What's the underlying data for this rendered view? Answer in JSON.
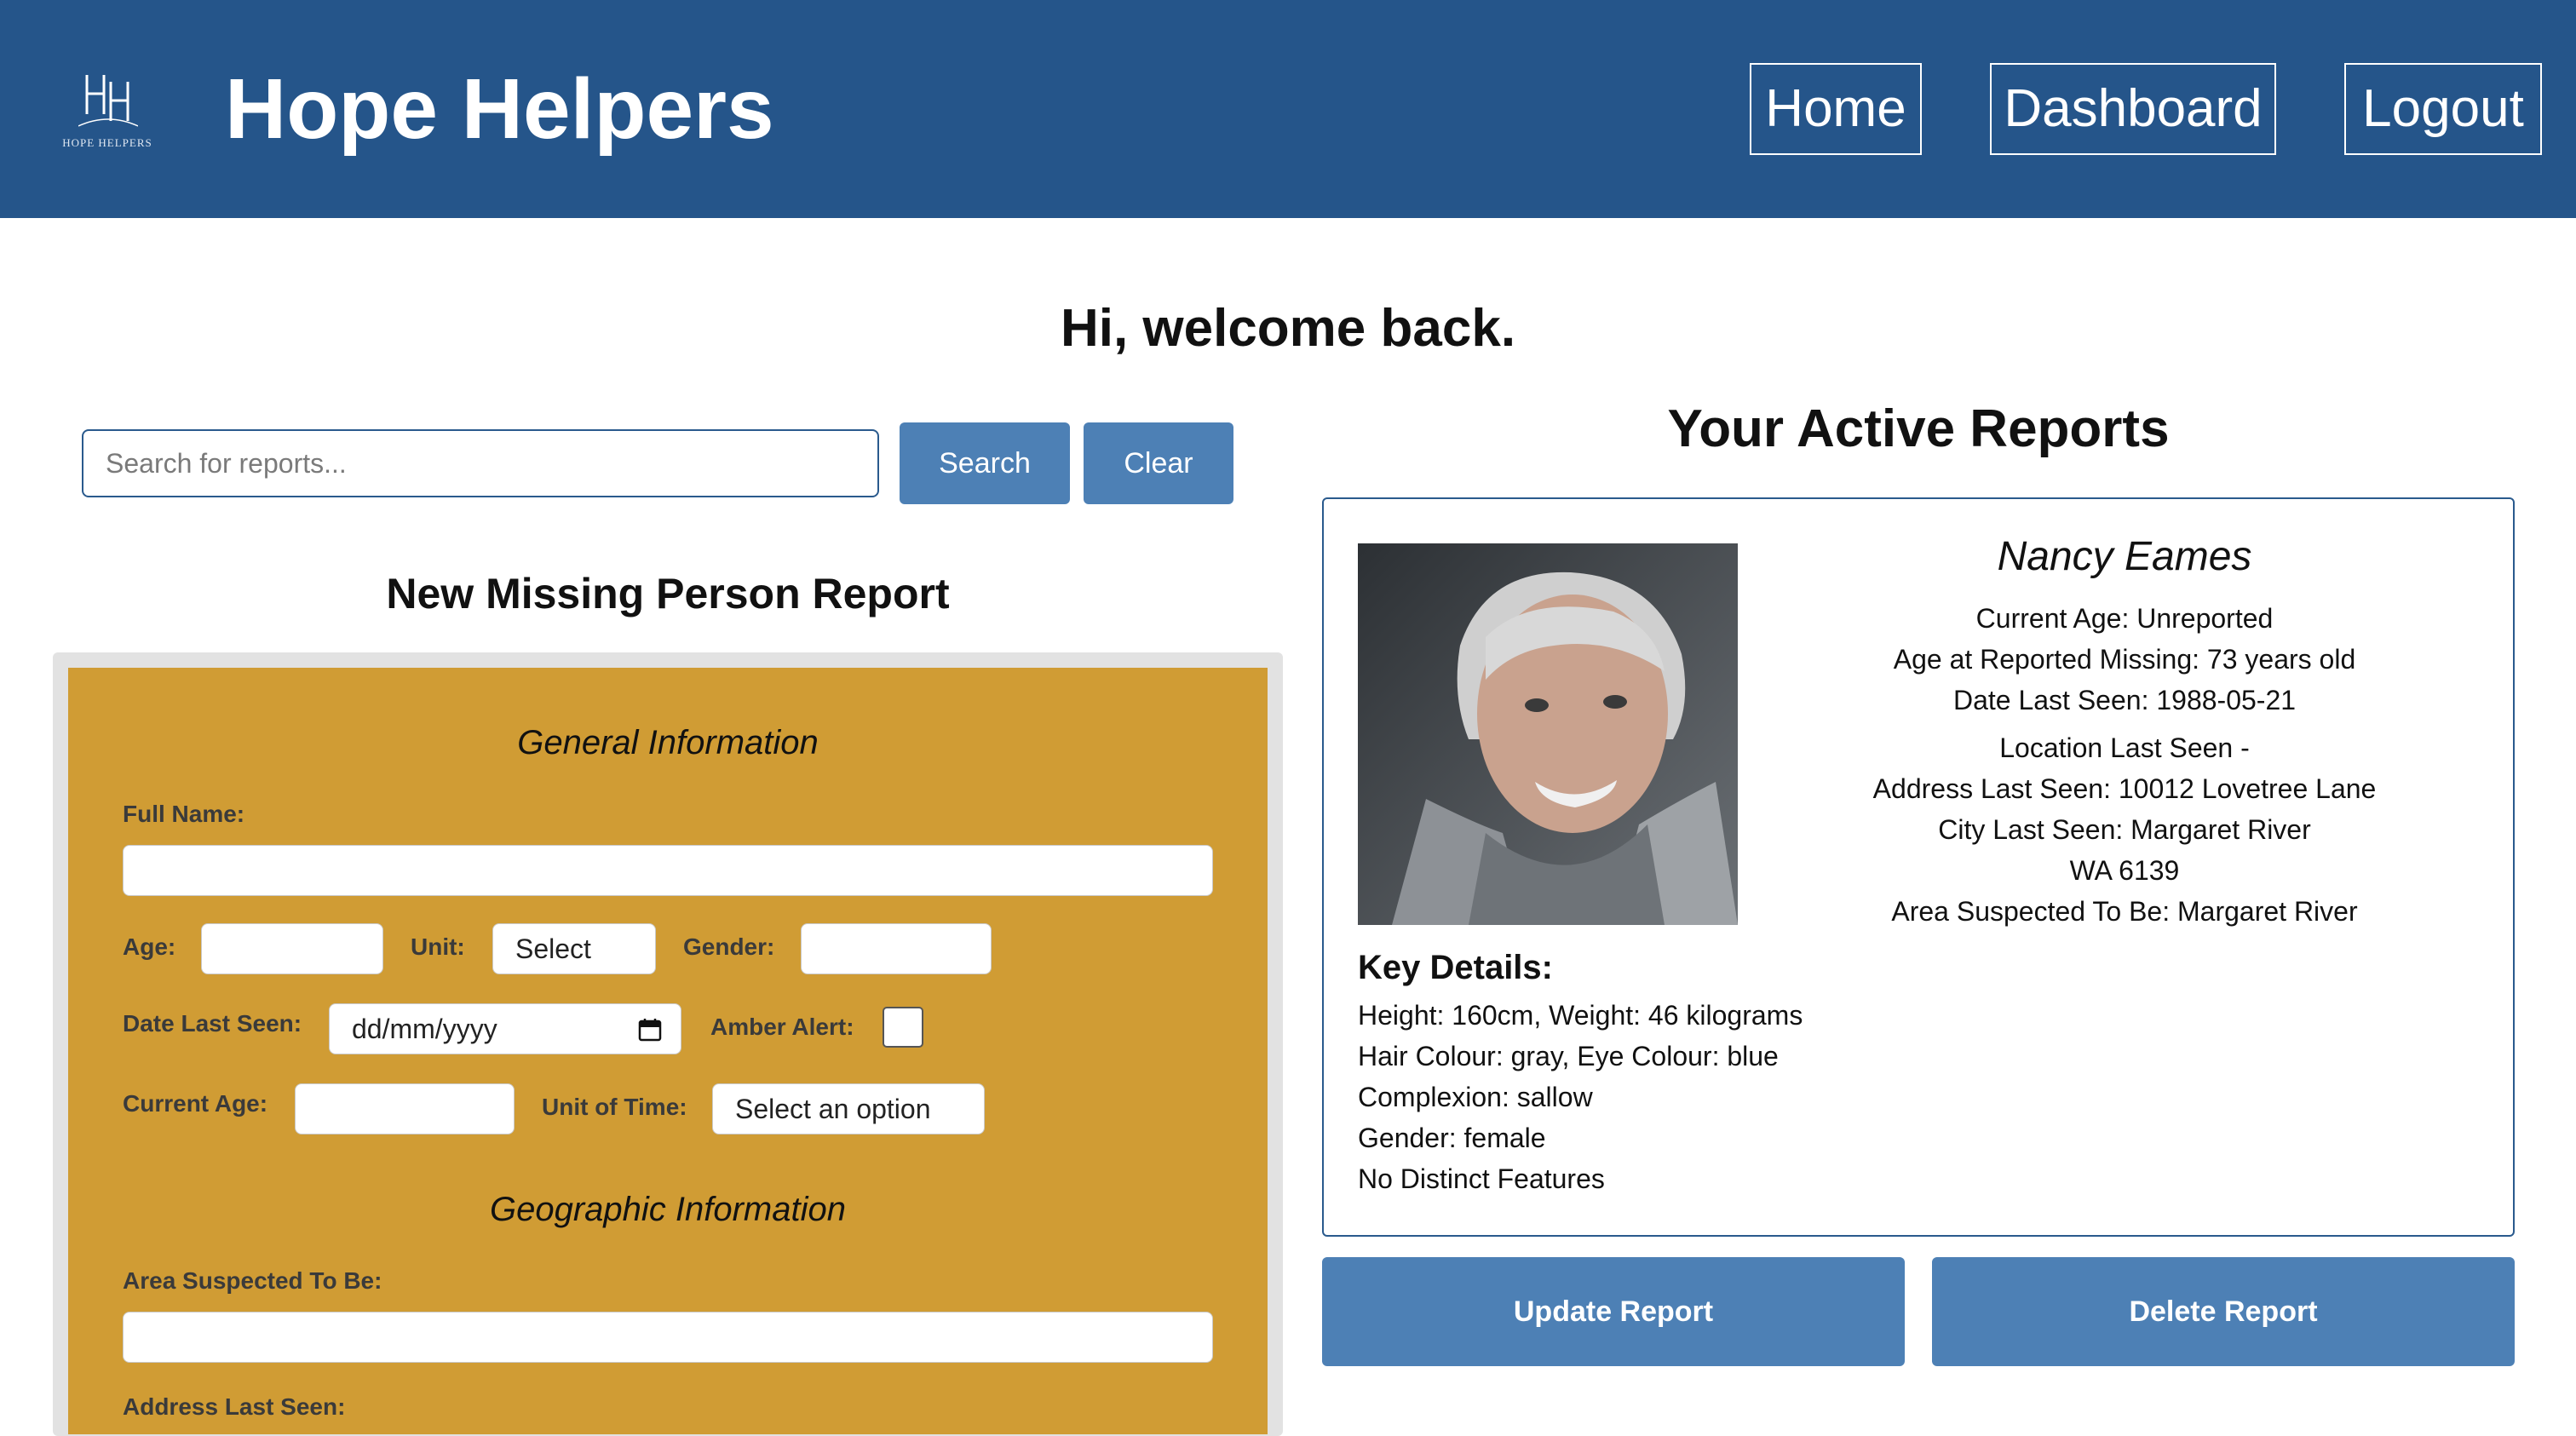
{
  "header": {
    "logo_text": "HOPE HELPERS",
    "brand": "Hope Helpers",
    "nav": {
      "home": "Home",
      "dashboard": "Dashboard",
      "logout": "Logout"
    }
  },
  "welcome": "Hi, welcome back.",
  "search": {
    "placeholder": "Search for reports...",
    "search_label": "Search",
    "clear_label": "Clear"
  },
  "new_report": {
    "title": "New Missing Person Report",
    "general_title": "General Information",
    "full_name_label": "Full Name:",
    "age_label": "Age:",
    "unit_label": "Unit:",
    "unit_value": "Select",
    "gender_label": "Gender:",
    "date_last_seen_label": "Date Last Seen:",
    "date_placeholder": "dd/mm/yyyy",
    "amber_alert_label": "Amber Alert:",
    "current_age_label": "Current Age:",
    "unit_of_time_label": "Unit of Time:",
    "unit_of_time_value": "Select an option",
    "geo_title": "Geographic Information",
    "area_suspected_label": "Area Suspected To Be:",
    "address_last_seen_label": "Address Last Seen:"
  },
  "reports": {
    "title": "Your Active Reports",
    "person": {
      "name": "Nancy Eames",
      "current_age": "Current Age: Unreported",
      "age_missing": "Age at Reported Missing: 73 years old",
      "date_last_seen": "Date Last Seen: 1988-05-21",
      "location_heading": "Location Last Seen -",
      "address": "Address Last Seen: 10012 Lovetree Lane",
      "city": "City Last Seen: Margaret River",
      "state": "WA 6139",
      "area": "Area Suspected To Be: Margaret River",
      "key_title": "Key Details:",
      "key_details": [
        "Height: 160cm, Weight: 46 kilograms",
        "Hair Colour: gray, Eye Colour: blue",
        "Complexion: sallow",
        "Gender: female",
        "No Distinct Features"
      ]
    },
    "update_label": "Update Report",
    "delete_label": "Delete Report"
  },
  "colors": {
    "header": "#25558a",
    "button": "#4d80b5",
    "form": "#d09c34"
  }
}
